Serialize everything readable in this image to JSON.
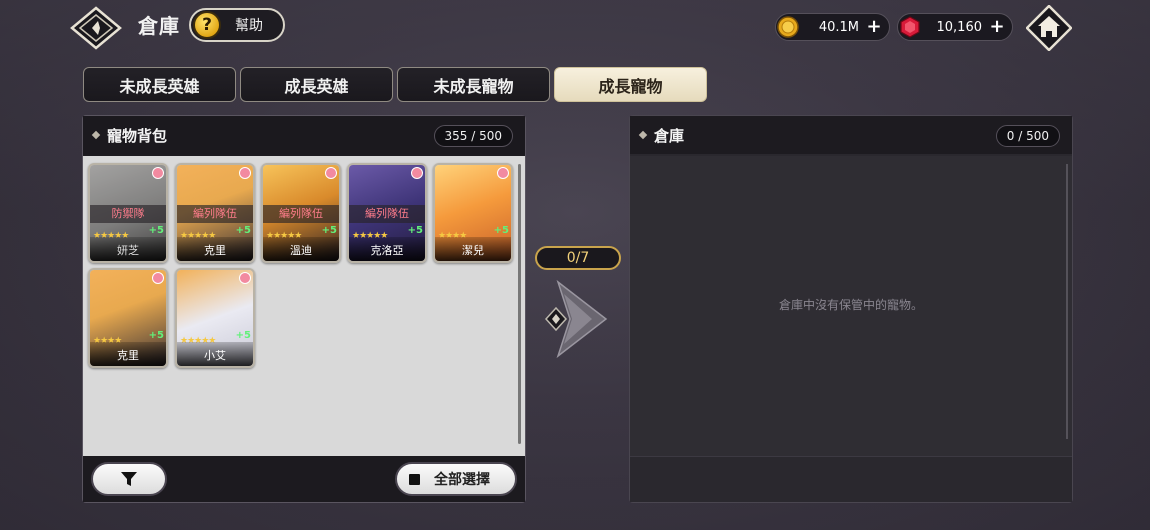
{
  "header": {
    "title": "倉庫",
    "help_label": "幫助",
    "help_icon": "?"
  },
  "currency": {
    "gold": {
      "value": "40.1M",
      "icon": "coin-icon"
    },
    "gem": {
      "value": "10,160",
      "icon": "ruby-icon"
    }
  },
  "tabs": [
    {
      "label": "未成長英雄",
      "active": false
    },
    {
      "label": "成長英雄",
      "active": false
    },
    {
      "label": "未成長寵物",
      "active": false
    },
    {
      "label": "成長寵物",
      "active": true
    }
  ],
  "left_panel": {
    "title": "寵物背包",
    "count": "355 / 500",
    "select_all_label": "全部選擇",
    "pets": [
      {
        "name": "妍芝",
        "tag": "防禦隊",
        "stars": "★★★★★",
        "plus": "+5",
        "locked": true,
        "palette": "gray"
      },
      {
        "name": "克里",
        "tag": "編列隊伍",
        "stars": "★★★★★",
        "plus": "+5",
        "locked": false,
        "palette": "orange"
      },
      {
        "name": "溫迪",
        "tag": "編列隊伍",
        "stars": "★★★★★",
        "plus": "+5",
        "locked": false,
        "palette": "amber"
      },
      {
        "name": "克洛亞",
        "tag": "編列隊伍",
        "stars": "★★★★★",
        "plus": "+5",
        "locked": false,
        "palette": "purple"
      },
      {
        "name": "潔兒",
        "tag": "",
        "stars": "★★★★",
        "plus": "+5",
        "locked": false,
        "palette": "sunset"
      },
      {
        "name": "克里",
        "tag": "",
        "stars": "★★★★",
        "plus": "+5",
        "locked": false,
        "palette": "orange"
      },
      {
        "name": "小艾",
        "tag": "",
        "stars": "★★★★★",
        "plus": "+5",
        "locked": false,
        "palette": "white"
      }
    ]
  },
  "transfer": {
    "count": "0/7"
  },
  "right_panel": {
    "title": "倉庫",
    "count": "0 / 500",
    "empty_message": "倉庫中沒有保管中的寵物。"
  },
  "colors": {
    "accent_gold": "#c9a44c",
    "active_tab_bg": "#efe6cd",
    "tag_red": "#ff7d8c"
  }
}
